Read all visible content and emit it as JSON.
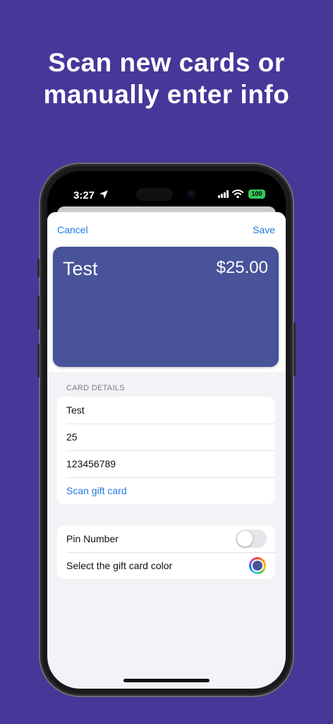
{
  "headline": {
    "line1": "Scan new cards or",
    "line2": "manually enter info"
  },
  "status_bar": {
    "time": "3:27",
    "battery": "100"
  },
  "nav": {
    "cancel": "Cancel",
    "save": "Save"
  },
  "card_preview": {
    "name": "Test",
    "amount": "$25.00",
    "color": "#48539a"
  },
  "card_details": {
    "section_label": "CARD DETAILS",
    "name_value": "Test",
    "amount_value": "25",
    "number_value": "123456789",
    "scan_label": "Scan gift card"
  },
  "options": {
    "pin_label": "Pin Number",
    "pin_enabled": false,
    "color_label": "Select the gift card color"
  },
  "colors": {
    "background": "#483699",
    "accent": "#1f7ae0"
  }
}
